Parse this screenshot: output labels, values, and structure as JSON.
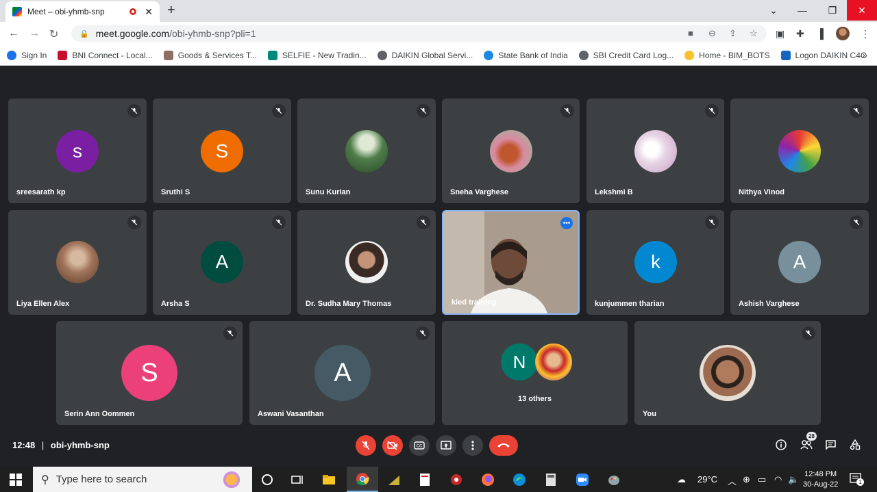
{
  "browser": {
    "tab_title": "Meet – obi-yhmb-snp",
    "url_host": "meet.google.com",
    "url_path": "/obi-yhmb-snp?pli=1",
    "bookmarks": [
      {
        "label": "Sign In",
        "color": "#1a73e8"
      },
      {
        "label": "BNI Connect - Local...",
        "color": "#c8102e"
      },
      {
        "label": "Goods & Services T...",
        "color": "#8d6e63"
      },
      {
        "label": "SELFIE - New Tradin...",
        "color": "#00897b"
      },
      {
        "label": "DAIKIN Global Servi...",
        "color": "#5f6368"
      },
      {
        "label": "State Bank of India",
        "color": "#1e88e5"
      },
      {
        "label": "SBI Credit Card Log...",
        "color": "#5f6368"
      },
      {
        "label": "Home - BIM_BOTS",
        "color": "#fbc02d"
      },
      {
        "label": "Logon DAIKIN C4C",
        "color": "#1565c0"
      }
    ]
  },
  "participants": [
    {
      "name": "sreesarath kp",
      "initial": "s",
      "color": "#7b1fa2"
    },
    {
      "name": "Sruthi S",
      "initial": "S",
      "color": "#ef6c00"
    },
    {
      "name": "Sunu Kurian",
      "initial": "",
      "color": "#4e7d4a"
    },
    {
      "name": "Sneha Varghese",
      "initial": "",
      "color": "#d98aa0"
    },
    {
      "name": "Lekshmi B",
      "initial": "",
      "color": "#e8d6e6"
    },
    {
      "name": "Nithya Vinod",
      "initial": "",
      "color": "#5c4db1"
    },
    {
      "name": "Liya Ellen Alex",
      "initial": "",
      "color": "#a1745a"
    },
    {
      "name": "Arsha S",
      "initial": "A",
      "color": "#004d40"
    },
    {
      "name": "Dr. Sudha Mary Thomas",
      "initial": "",
      "color": "#6b4636"
    },
    {
      "name": "kied training",
      "initial": "",
      "color": "#a89a8c"
    },
    {
      "name": "kunjummen tharian",
      "initial": "k",
      "color": "#0288d1"
    },
    {
      "name": "Ashish Varghese",
      "initial": "A",
      "color": "#78909c"
    },
    {
      "name": "Serin Ann Oommen",
      "initial": "S",
      "color": "#ec407a"
    },
    {
      "name": "Aswani Vasanthan",
      "initial": "A",
      "color": "#455a64"
    },
    {
      "name": "13 others",
      "initial": "N",
      "color": "#00796b"
    },
    {
      "name": "You",
      "initial": "",
      "color": "#9c6b52"
    }
  ],
  "meeting": {
    "time": "12:48",
    "separator": "|",
    "code": "obi-yhmb-snp",
    "participant_count": "28"
  },
  "taskbar": {
    "search_placeholder": "Type here to search",
    "temperature": "29°C",
    "time": "12:48 PM",
    "date": "30-Aug-22",
    "notifications": "1"
  },
  "icons": {
    "mic_off": "mic-off-icon",
    "cam_off": "camera-off-icon",
    "captions": "captions-icon",
    "present": "present-icon",
    "more": "more-vert-icon",
    "end_call": "phone-hangup-icon"
  }
}
